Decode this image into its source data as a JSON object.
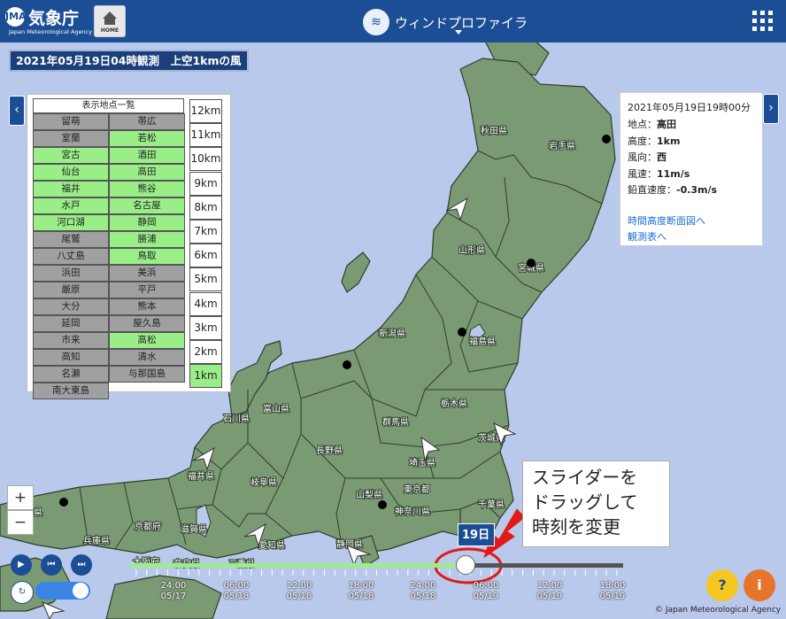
{
  "header": {
    "logo_jp": "気象庁",
    "logo_en": "Japan Meteorological Agency",
    "logo_mark": "JMA",
    "home_label": "HOME",
    "title": "ウィンドプロファイラ"
  },
  "observation_title": "2021年05月19日04時観測　上空1kmの風",
  "colors": {
    "header": "#1c4e95",
    "land": "#7a9a74",
    "sea": "#b9c9ec",
    "active_station": "#99ee88",
    "inactive_station": "#a0a0a0",
    "callout_circle": "#e31919"
  },
  "station_panel": {
    "header": "表示地点一覧",
    "stations": [
      {
        "name": "留萌",
        "active": false
      },
      {
        "name": "帯広",
        "active": false
      },
      {
        "name": "室蘭",
        "active": false
      },
      {
        "name": "若松",
        "active": true
      },
      {
        "name": "宮古",
        "active": true
      },
      {
        "name": "酒田",
        "active": true
      },
      {
        "name": "仙台",
        "active": true
      },
      {
        "name": "高田",
        "active": true
      },
      {
        "name": "福井",
        "active": true
      },
      {
        "name": "熊谷",
        "active": true
      },
      {
        "name": "水戸",
        "active": true
      },
      {
        "name": "名古屋",
        "active": true
      },
      {
        "name": "河口湖",
        "active": true
      },
      {
        "name": "静岡",
        "active": true
      },
      {
        "name": "尾鷲",
        "active": false
      },
      {
        "name": "勝浦",
        "active": true
      },
      {
        "name": "八丈島",
        "active": false
      },
      {
        "name": "鳥取",
        "active": true
      },
      {
        "name": "浜田",
        "active": false
      },
      {
        "name": "美浜",
        "active": false
      },
      {
        "name": "厳原",
        "active": false
      },
      {
        "name": "平戸",
        "active": false
      },
      {
        "name": "大分",
        "active": false
      },
      {
        "name": "熊本",
        "active": false
      },
      {
        "name": "延岡",
        "active": false
      },
      {
        "name": "屋久島",
        "active": false
      },
      {
        "name": "市来",
        "active": false
      },
      {
        "name": "高松",
        "active": true
      },
      {
        "name": "高知",
        "active": false
      },
      {
        "name": "清水",
        "active": false
      },
      {
        "name": "名瀬",
        "active": false
      },
      {
        "name": "与那国島",
        "active": false
      },
      {
        "name": "南大東島",
        "active": false
      }
    ],
    "altitudes": [
      {
        "label": "12km",
        "selected": false
      },
      {
        "label": "11km",
        "selected": false
      },
      {
        "label": "10km",
        "selected": false
      },
      {
        "label": "9km",
        "selected": false
      },
      {
        "label": "8km",
        "selected": false
      },
      {
        "label": "7km",
        "selected": false
      },
      {
        "label": "6km",
        "selected": false
      },
      {
        "label": "5km",
        "selected": false
      },
      {
        "label": "4km",
        "selected": false
      },
      {
        "label": "3km",
        "selected": false
      },
      {
        "label": "2km",
        "selected": false
      },
      {
        "label": "1km",
        "selected": true
      }
    ]
  },
  "info_panel": {
    "datetime": "2021年05月19日19時00分",
    "rows": [
      {
        "label": "地点：",
        "value": "高田"
      },
      {
        "label": "高度：",
        "value": "1km"
      },
      {
        "label": "風向：",
        "value": "西"
      },
      {
        "label": "風速：",
        "value": "11m/s"
      },
      {
        "label": "鉛直速度：",
        "value": "-0.3m/s"
      }
    ],
    "links": [
      "時間高度断面図へ",
      "観測表へ"
    ]
  },
  "map": {
    "prefectures": [
      "秋田県",
      "岩手県",
      "山形県",
      "宮城県",
      "新潟県",
      "福島県",
      "富山県",
      "石川県",
      "群馬県",
      "栃木県",
      "茨城県",
      "長野県",
      "埼玉県",
      "福井県",
      "岐阜県",
      "山梨県",
      "東京都",
      "千葉県",
      "京都府",
      "滋賀県",
      "愛知県",
      "神奈川県",
      "静岡県",
      "兵庫県",
      "大阪府",
      "奈良県",
      "三重県",
      "県"
    ]
  },
  "zoom": {
    "in": "+",
    "out": "−"
  },
  "timeline": {
    "bubble": "19日",
    "progress": 0.68,
    "ticks": [
      {
        "time": "24:00",
        "date": "05/17"
      },
      {
        "time": "06:00",
        "date": "05/18"
      },
      {
        "time": "12:00",
        "date": "05/18"
      },
      {
        "time": "18:00",
        "date": "05/18"
      },
      {
        "time": "24:00",
        "date": "05/18"
      },
      {
        "time": "06:00",
        "date": "05/19"
      },
      {
        "time": "12:00",
        "date": "05/19"
      },
      {
        "time": "18:00",
        "date": "05/19"
      }
    ]
  },
  "callout": {
    "lines": [
      "スライダーを",
      "ドラッグして",
      "時刻を変更"
    ]
  },
  "icons": {
    "play": "play-icon",
    "skip_back": "skip-back-icon",
    "skip_forward": "skip-forward-icon",
    "help": "help-icon",
    "manual": "book-icon"
  },
  "copyright": "© Japan Meteorological Agency"
}
